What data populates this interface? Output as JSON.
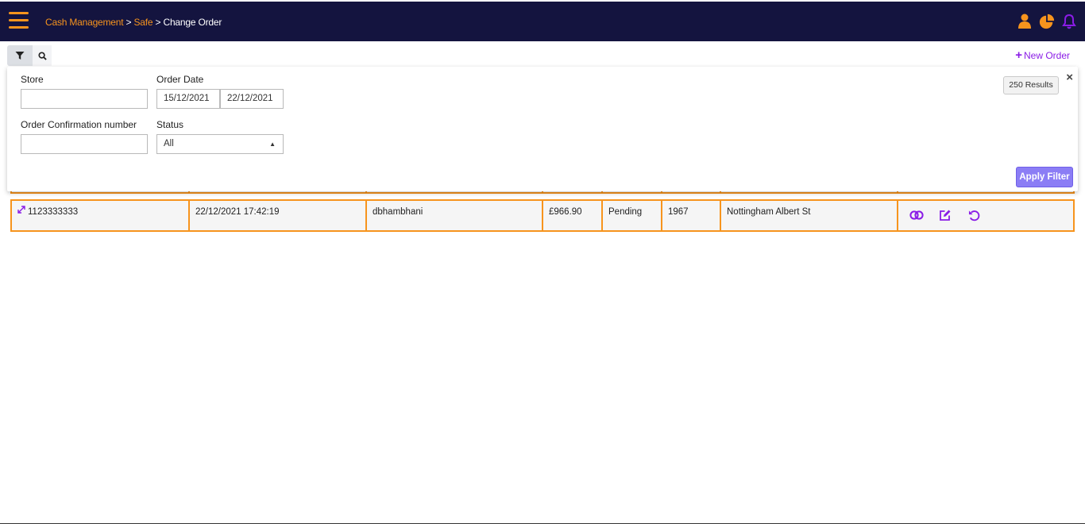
{
  "header": {
    "breadcrumb": [
      {
        "label": "Cash Management",
        "link": true
      },
      {
        "label": "Safe",
        "link": true
      },
      {
        "label": "Change Order",
        "link": false
      }
    ],
    "separator": ">",
    "icons": [
      "user-icon",
      "pie-chart-icon",
      "bell-icon"
    ],
    "accent": "#f7941d",
    "bg": "#14143f"
  },
  "toolbar": {
    "filter_icon": "filter-icon",
    "search_icon": "search-icon",
    "new_order_label": "New Order",
    "new_order_plus": "+"
  },
  "filter": {
    "store_label": "Store",
    "store_value": "",
    "order_date_label": "Order Date",
    "date_from": "15/12/2021",
    "date_to": "22/12/2021",
    "confirmation_label": "Order Confirmation number",
    "confirmation_value": "",
    "status_label": "Status",
    "status_value": "All",
    "results": "250 Results",
    "close": "×",
    "apply_label": "Apply Filter"
  },
  "table": {
    "rows": [
      {
        "order_id": "1123333333",
        "datetime": "22/12/2021 17:42:19",
        "user": "dbhambhani",
        "amount": "£966.90",
        "status": "Pending",
        "store_no": "1967",
        "store_name": "Nottingham Albert St",
        "actions": [
          "toggle-icon",
          "edit-icon",
          "undo-icon"
        ]
      }
    ]
  }
}
